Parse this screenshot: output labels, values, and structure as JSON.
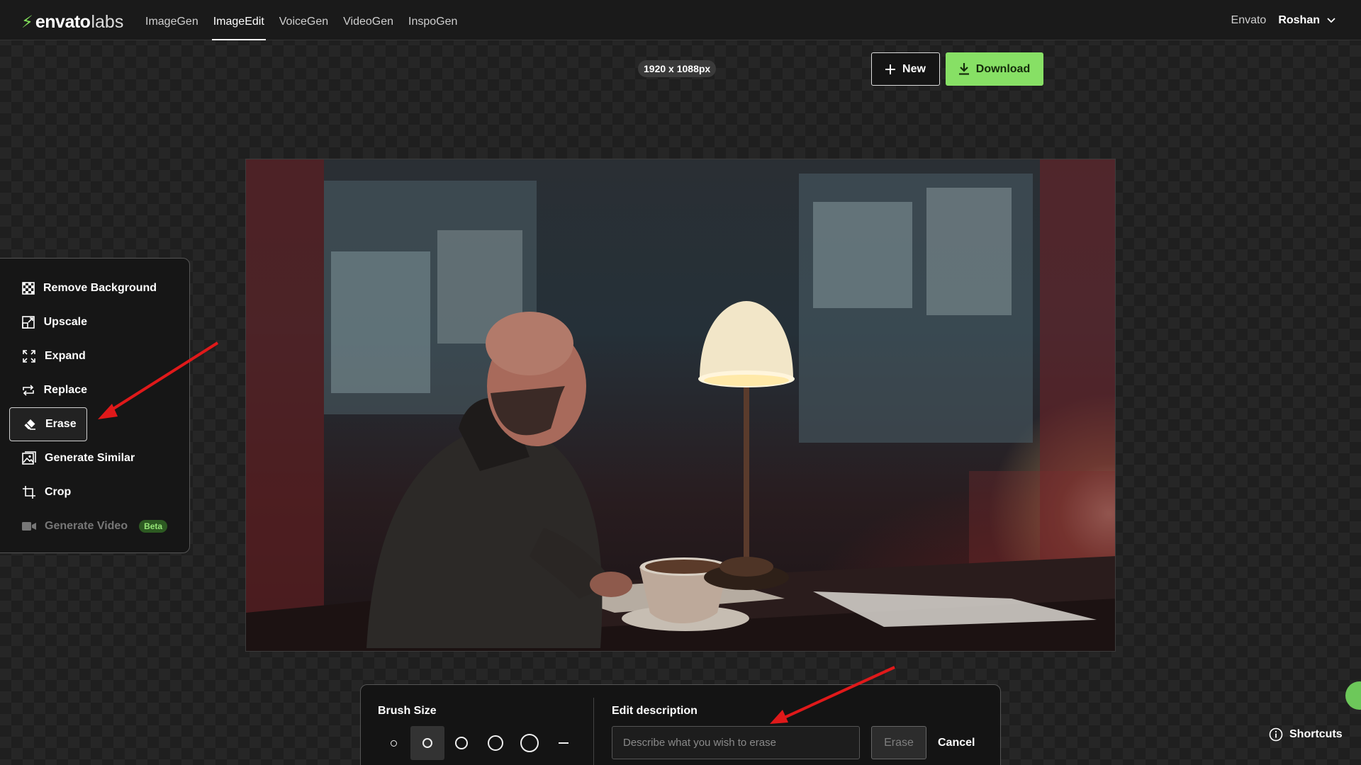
{
  "header": {
    "logo_brand": "envato",
    "logo_suffix": "labs",
    "nav": [
      {
        "label": "ImageGen"
      },
      {
        "label": "ImageEdit"
      },
      {
        "label": "VoiceGen"
      },
      {
        "label": "VideoGen"
      },
      {
        "label": "InspoGen"
      }
    ],
    "active_nav": "ImageEdit",
    "envato_link": "Envato",
    "user_name": "Roshan"
  },
  "canvas": {
    "size_label": "1920 x 1088px",
    "new_label": "New",
    "download_label": "Download"
  },
  "tools": [
    {
      "label": "Remove Background",
      "icon": "checkerboard-icon"
    },
    {
      "label": "Upscale",
      "icon": "upscale-icon"
    },
    {
      "label": "Expand",
      "icon": "expand-icon"
    },
    {
      "label": "Replace",
      "icon": "replace-icon"
    },
    {
      "label": "Erase",
      "icon": "eraser-icon",
      "selected": true
    },
    {
      "label": "Generate Similar",
      "icon": "image-icon"
    },
    {
      "label": "Crop",
      "icon": "crop-icon"
    },
    {
      "label": "Generate Video",
      "icon": "video-camera-icon",
      "disabled": true,
      "badge": "Beta"
    }
  ],
  "erase_panel": {
    "brush_size_label": "Brush Size",
    "brush_sizes": [
      "xs",
      "s",
      "m",
      "l",
      "xl",
      "line"
    ],
    "selected_brush": "s",
    "edit_description_label": "Edit description",
    "input_placeholder": "Describe what you wish to erase",
    "input_value": "",
    "erase_label": "Erase",
    "cancel_label": "Cancel"
  },
  "footer": {
    "shortcuts_label": "Shortcuts"
  },
  "colors": {
    "accent_green": "#87e065",
    "annotation_red": "#e0191a"
  }
}
